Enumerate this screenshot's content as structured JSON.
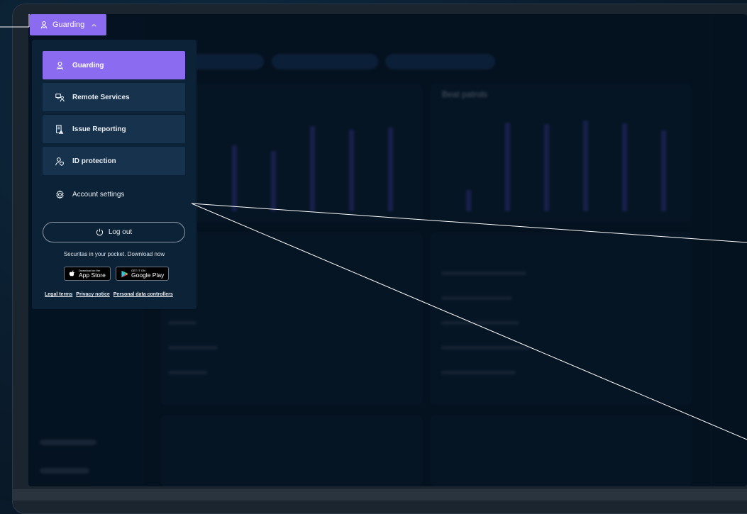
{
  "trigger": {
    "label": "Guarding",
    "icon": "guard-icon",
    "chevron": "chevron-up-icon"
  },
  "menu": {
    "items": [
      {
        "label": "Guarding",
        "icon": "guard-icon",
        "active": true
      },
      {
        "label": "Remote Services",
        "icon": "remote-services-icon",
        "active": false
      },
      {
        "label": "Issue Reporting",
        "icon": "issue-reporting-icon",
        "active": false
      },
      {
        "label": "ID protection",
        "icon": "id-protection-icon",
        "active": false
      }
    ],
    "account_settings": "Account settings",
    "logout": "Log out",
    "promo": "Securitas in your pocket. Download now",
    "app_store": {
      "small": "Download on the",
      "big": "App Store"
    },
    "google_play": {
      "small": "GET IT ON",
      "big": "Google Play"
    },
    "links": [
      "Legal terms",
      "Privacy notice",
      "Personal data controllers"
    ]
  },
  "colors": {
    "accent": "#8b6cf0",
    "menu_bg": "#0c2236",
    "item_bg": "#17324c",
    "screen_bg": "#061524"
  },
  "background_dashboard": {
    "card_title_right": "Beat patrols"
  }
}
